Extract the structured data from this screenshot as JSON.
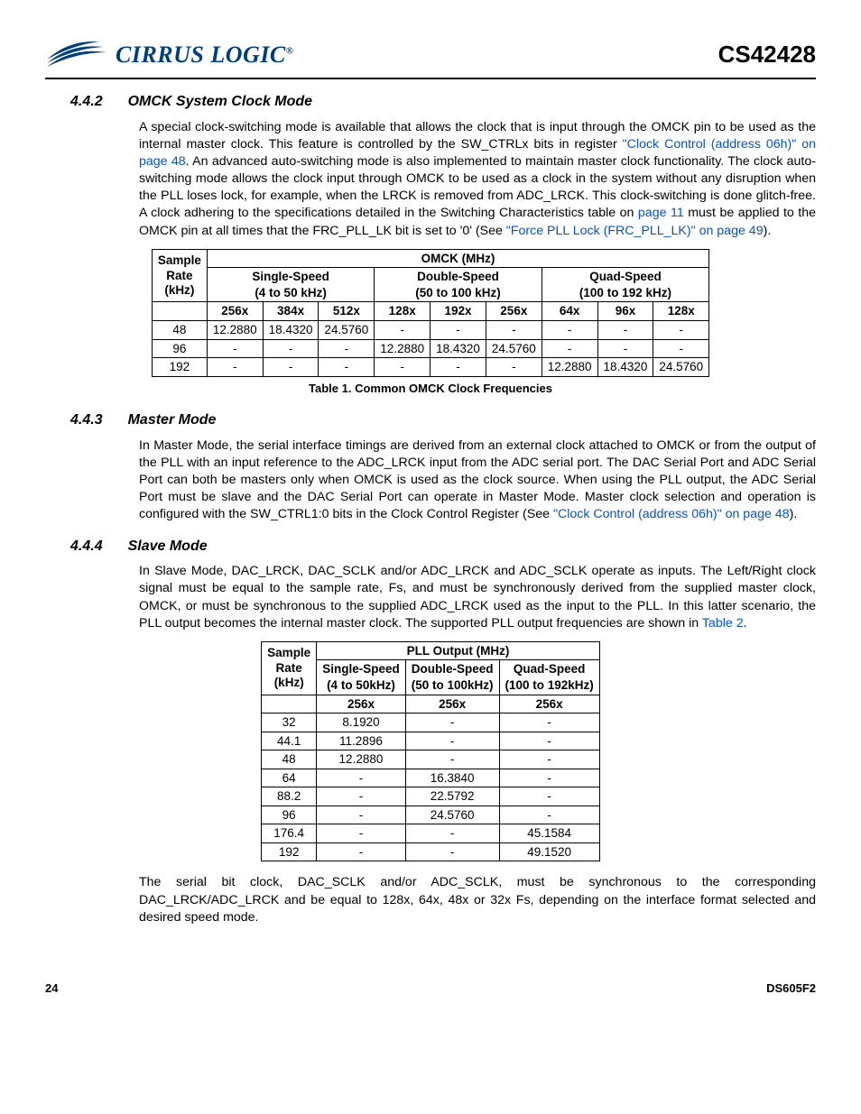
{
  "header": {
    "company": "CIRRUS LOGIC",
    "reg": "®",
    "part": "CS42428"
  },
  "sec442": {
    "num": "4.4.2",
    "title": "OMCK System Clock Mode",
    "p1a": "A special clock-switching mode is available that allows the clock that is input through the OMCK pin to be used as the internal master clock. This feature is controlled by the SW_CTRLx bits in register ",
    "link1": "\"Clock Control (address 06h)\" on page 48",
    "p1b": ". An advanced auto-switching mode is also implemented to maintain master clock functionality. The clock auto-switching mode allows the clock input through OMCK to be used as a clock in the system without any disruption when the PLL loses lock, for example, when the LRCK is removed from ADC_LRCK. This clock-switching is done glitch-free. A clock adhering to the specifications detailed in the Switching Characteristics table on ",
    "link2": "page 11",
    "p1c": " must be applied to the OMCK pin at all times that the FRC_PLL_LK bit is set to '0' (See ",
    "link3": "\"Force PLL Lock (FRC_PLL_LK)\" on page 49",
    "p1d": ")."
  },
  "table1": {
    "h_sample": "Sample Rate (kHz)",
    "h_omck": "OMCK (MHz)",
    "h_single": "Single-Speed",
    "h_single_sub": "(4 to 50 kHz)",
    "h_double": "Double-Speed",
    "h_double_sub": "(50 to 100 kHz)",
    "h_quad": "Quad-Speed",
    "h_quad_sub": "(100 to 192 kHz)",
    "mult": [
      "256x",
      "384x",
      "512x",
      "128x",
      "192x",
      "256x",
      "64x",
      "96x",
      "128x"
    ],
    "rows": [
      {
        "rate": "48",
        "v": [
          "12.2880",
          "18.4320",
          "24.5760",
          "-",
          "-",
          "-",
          "-",
          "-",
          "-"
        ]
      },
      {
        "rate": "96",
        "v": [
          "-",
          "-",
          "-",
          "12.2880",
          "18.4320",
          "24.5760",
          "-",
          "-",
          "-"
        ]
      },
      {
        "rate": "192",
        "v": [
          "-",
          "-",
          "-",
          "-",
          "-",
          "-",
          "12.2880",
          "18.4320",
          "24.5760"
        ]
      }
    ],
    "caption": "Table 1. Common OMCK Clock Frequencies"
  },
  "sec443": {
    "num": "4.4.3",
    "title": "Master Mode",
    "p1a": "In Master Mode, the serial interface timings are derived from an external clock attached to OMCK or from the output of the PLL with an input reference to the ADC_LRCK input from the ADC serial port. The DAC Serial Port and ADC Serial Port can both be masters only when OMCK is used as the clock source. When using the PLL output, the ADC Serial Port must be slave and the DAC Serial Port can operate in Master Mode. Master clock selection and operation is configured with the SW_CTRL1:0 bits in the Clock Control Register (See ",
    "link1": "\"Clock Control (address 06h)\" on page 48",
    "p1b": ")."
  },
  "sec444": {
    "num": "4.4.4",
    "title": "Slave Mode",
    "p1a": "In Slave Mode, DAC_LRCK, DAC_SCLK and/or ADC_LRCK and ADC_SCLK operate as inputs. The Left/Right clock signal must be equal to the sample rate, Fs, and must be synchronously derived from the supplied master clock, OMCK, or must be synchronous to the supplied ADC_LRCK used as the input to the PLL. In this latter scenario, the PLL output becomes the internal master clock. The supported PLL output frequencies are shown in ",
    "link1": "Table 2",
    "p1b": ".",
    "p2": "The serial bit clock, DAC_SCLK and/or ADC_SCLK, must be synchronous to the corresponding DAC_LRCK/ADC_LRCK and be equal to 128x, 64x, 48x or 32x Fs, depending on the interface format selected and desired speed mode."
  },
  "table2": {
    "h_sample": "Sample Rate (kHz)",
    "h_pll": "PLL Output (MHz)",
    "h_single": "Single-Speed",
    "h_single_sub": "(4 to 50kHz)",
    "h_double": "Double-Speed",
    "h_double_sub": "(50 to 100kHz)",
    "h_quad": "Quad-Speed",
    "h_quad_sub": "(100 to 192kHz)",
    "mult": "256x",
    "rows": [
      {
        "rate": "32",
        "v": [
          "8.1920",
          "-",
          "-"
        ]
      },
      {
        "rate": "44.1",
        "v": [
          "11.2896",
          "-",
          "-"
        ]
      },
      {
        "rate": "48",
        "v": [
          "12.2880",
          "-",
          "-"
        ]
      },
      {
        "rate": "64",
        "v": [
          "-",
          "16.3840",
          "-"
        ]
      },
      {
        "rate": "88.2",
        "v": [
          "-",
          "22.5792",
          "-"
        ]
      },
      {
        "rate": "96",
        "v": [
          "-",
          "24.5760",
          "-"
        ]
      },
      {
        "rate": "176.4",
        "v": [
          "-",
          "-",
          "45.1584"
        ]
      },
      {
        "rate": "192",
        "v": [
          "-",
          "-",
          "49.1520"
        ]
      }
    ]
  },
  "footer": {
    "page": "24",
    "doc": "DS605F2"
  }
}
